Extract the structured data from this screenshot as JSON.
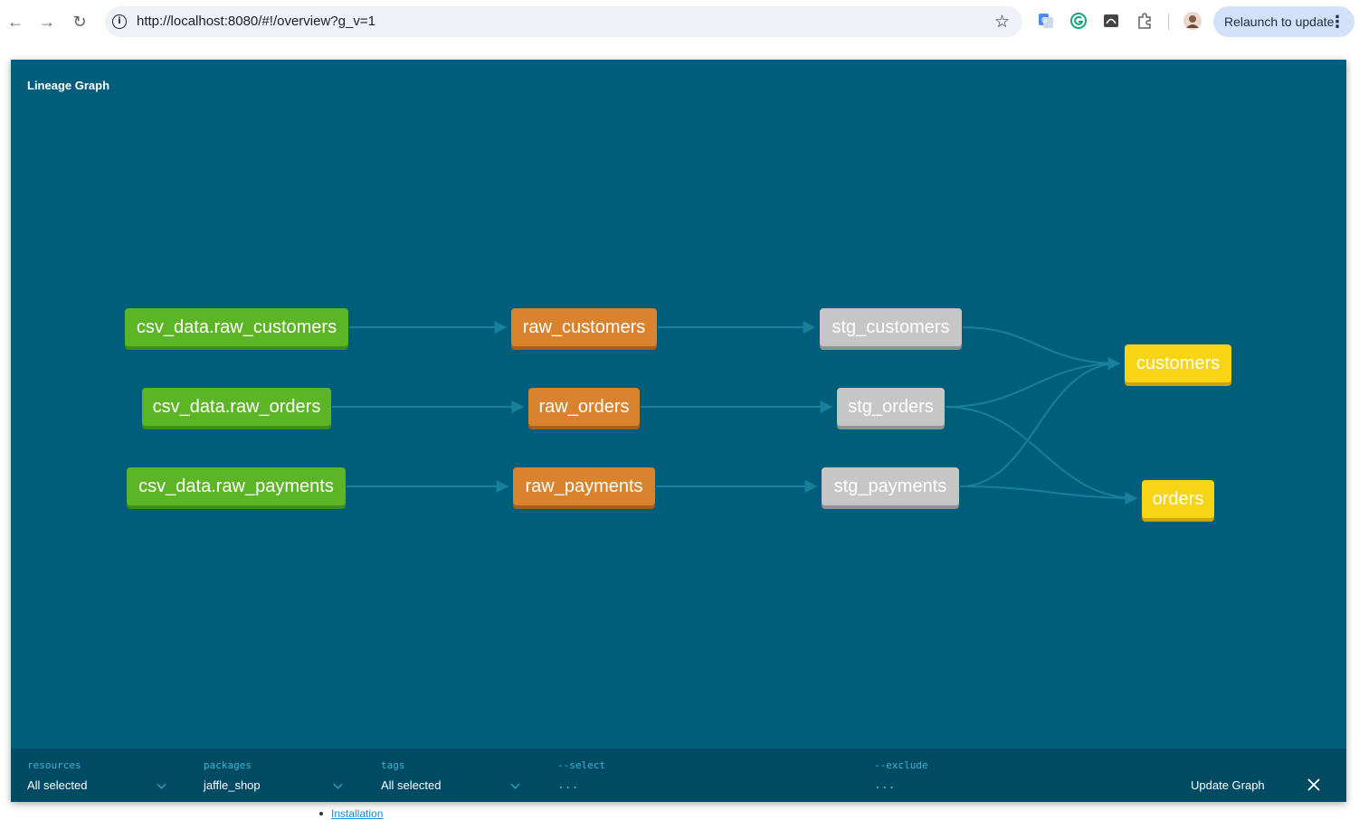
{
  "browser": {
    "url": "http://localhost:8080/#!/overview?g_v=1",
    "relaunch_label": "Relaunch to update"
  },
  "underlying_page": {
    "link_label": "Installation"
  },
  "modal": {
    "title": "Lineage Graph",
    "nodes": {
      "csv_customers": "csv_data.raw_customers",
      "csv_orders": "csv_data.raw_orders",
      "csv_payments": "csv_data.raw_payments",
      "raw_customers": "raw_customers",
      "raw_orders": "raw_orders",
      "raw_payments": "raw_payments",
      "stg_customers": "stg_customers",
      "stg_orders": "stg_orders",
      "stg_payments": "stg_payments",
      "customers": "customers",
      "orders": "orders"
    },
    "node_colors": {
      "source": "#5cb525",
      "seed": "#d9832f",
      "staging": "#c6c6c6",
      "mart": "#f7d414"
    },
    "filters": {
      "resources": {
        "label": "resources",
        "value": "All selected"
      },
      "packages": {
        "label": "packages",
        "value": "jaffle_shop"
      },
      "tags": {
        "label": "tags",
        "value": "All selected"
      },
      "select": {
        "label": "--select",
        "placeholder": "..."
      },
      "exclude": {
        "label": "--exclude",
        "placeholder": "..."
      }
    },
    "update_button": "Update Graph"
  }
}
